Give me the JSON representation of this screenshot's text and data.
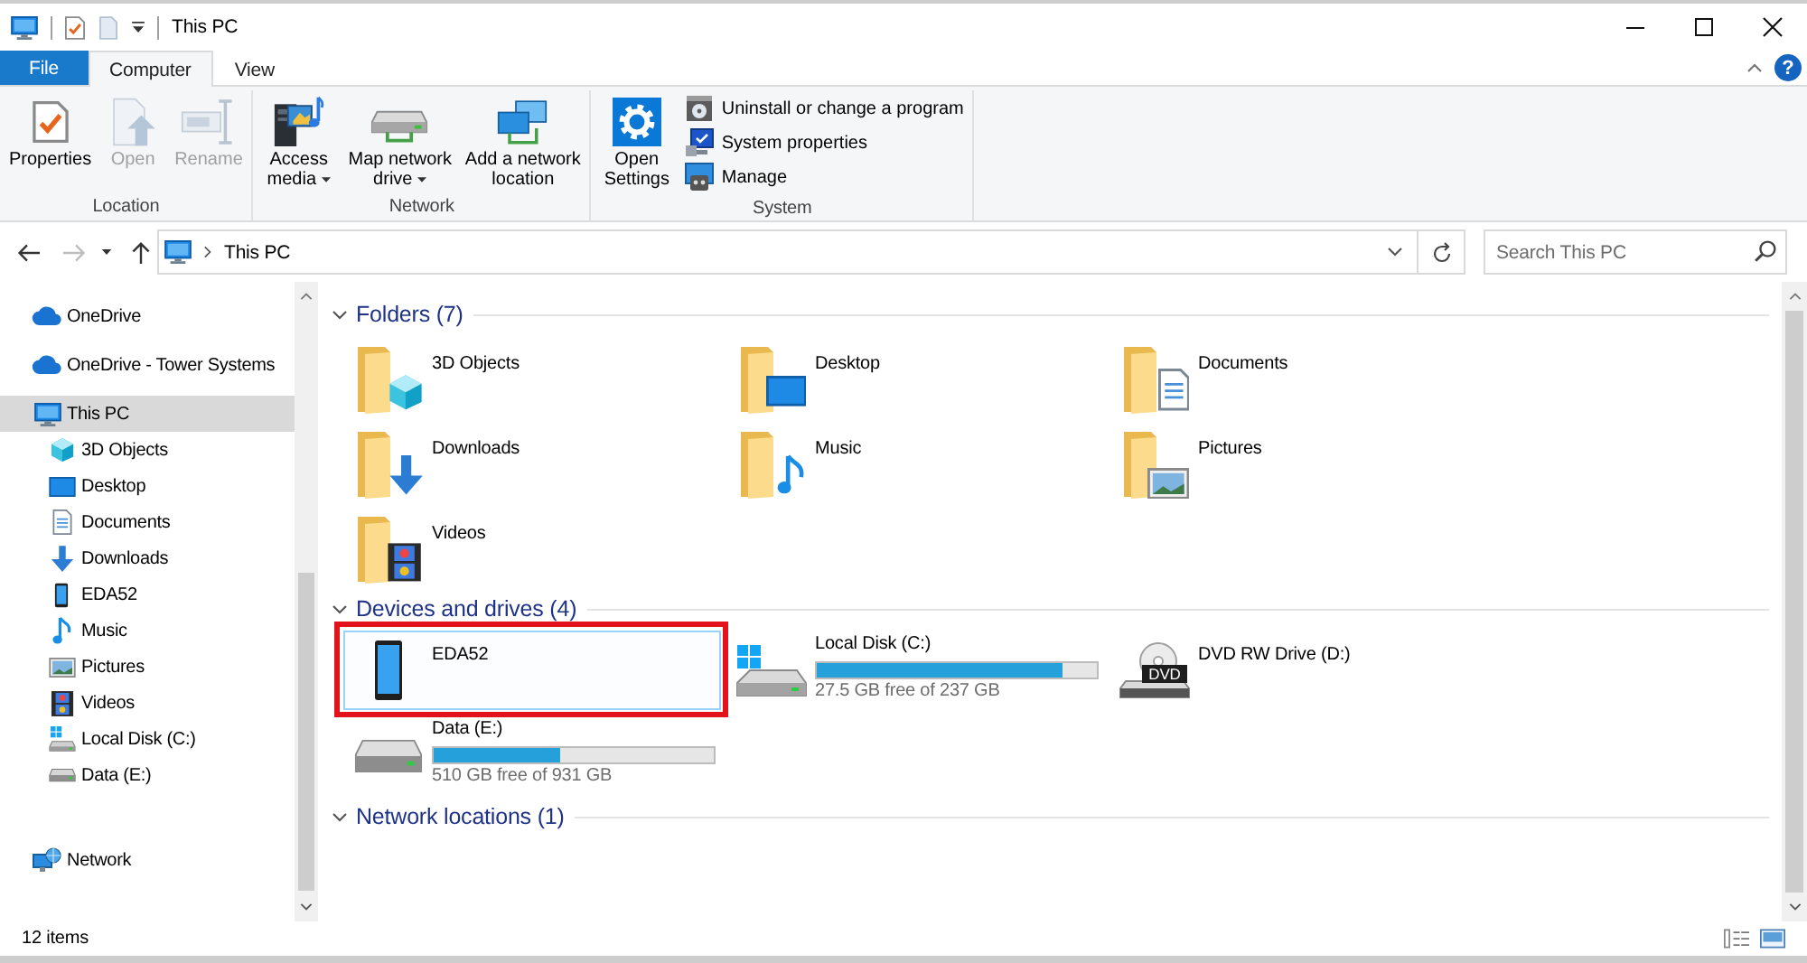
{
  "window": {
    "title": "This PC"
  },
  "ribbon": {
    "tabs": [
      {
        "label": "File",
        "kind": "file",
        "selected": false
      },
      {
        "label": "Computer",
        "kind": "tab",
        "selected": true
      },
      {
        "label": "View",
        "kind": "tab",
        "selected": false
      }
    ],
    "help_button": {
      "label": "?"
    },
    "groups": [
      {
        "label": "Location",
        "buttons": [
          {
            "label": "Properties",
            "kind": "large",
            "disabled": false,
            "dropdown": false
          },
          {
            "label": "Open",
            "kind": "large",
            "disabled": true,
            "dropdown": false
          },
          {
            "label": "Rename",
            "kind": "large",
            "disabled": true,
            "dropdown": false
          }
        ]
      },
      {
        "label": "Network",
        "buttons": [
          {
            "label": "Access media",
            "kind": "large",
            "disabled": false,
            "dropdown": true
          },
          {
            "label": "Map network drive",
            "kind": "large",
            "disabled": false,
            "dropdown": true
          },
          {
            "label": "Add a network location",
            "kind": "large",
            "disabled": false,
            "dropdown": false
          }
        ]
      },
      {
        "label": "System",
        "buttons": [
          {
            "label": "Open Settings",
            "kind": "large",
            "disabled": false,
            "dropdown": false
          },
          {
            "label": "Uninstall or change a program",
            "kind": "small",
            "disabled": false,
            "dropdown": false
          },
          {
            "label": "System properties",
            "kind": "small",
            "disabled": false,
            "dropdown": false
          },
          {
            "label": "Manage",
            "kind": "small",
            "disabled": false,
            "dropdown": false
          }
        ]
      }
    ]
  },
  "address": {
    "path": [
      "This PC"
    ]
  },
  "search": {
    "placeholder": "Search This PC"
  },
  "nav": {
    "items": [
      {
        "label": "OneDrive",
        "selected": false
      },
      {
        "label": "OneDrive - Tower Systems",
        "selected": false
      },
      {
        "label": "This PC",
        "selected": true,
        "children": [
          {
            "label": "3D Objects",
            "selected": false
          },
          {
            "label": "Desktop",
            "selected": false
          },
          {
            "label": "Documents",
            "selected": false
          },
          {
            "label": "Downloads",
            "selected": false
          },
          {
            "label": "EDA52",
            "selected": false
          },
          {
            "label": "Music",
            "selected": false
          },
          {
            "label": "Pictures",
            "selected": false
          },
          {
            "label": "Videos",
            "selected": false
          },
          {
            "label": "Local Disk (C:)",
            "selected": false
          },
          {
            "label": "Data (E:)",
            "selected": false
          }
        ]
      },
      {
        "label": "Network",
        "selected": false
      }
    ]
  },
  "content": {
    "groups": [
      {
        "title": "Folders (7)",
        "expanded": true,
        "items": [
          {
            "name": "3D Objects",
            "kind": "folder",
            "selected": false
          },
          {
            "name": "Desktop",
            "kind": "folder",
            "selected": false
          },
          {
            "name": "Documents",
            "kind": "folder",
            "selected": false
          },
          {
            "name": "Downloads",
            "kind": "folder",
            "selected": false
          },
          {
            "name": "Music",
            "kind": "folder",
            "selected": false
          },
          {
            "name": "Pictures",
            "kind": "folder",
            "selected": false
          },
          {
            "name": "Videos",
            "kind": "folder",
            "selected": false
          }
        ]
      },
      {
        "title": "Devices and drives (4)",
        "expanded": true,
        "items": [
          {
            "name": "EDA52",
            "kind": "device",
            "selected": true,
            "highlighted": true
          },
          {
            "name": "Local Disk (C:)",
            "kind": "system_drive",
            "selected": false,
            "highlighted": false,
            "level": 0.88,
            "free": "27.5 GB free of 237 GB"
          },
          {
            "name": "DVD RW Drive (D:)",
            "kind": "optical_drive",
            "badge": "DVD",
            "selected": false,
            "highlighted": false
          },
          {
            "name": "Data (E:)",
            "kind": "drive",
            "selected": false,
            "highlighted": false,
            "level": 0.45,
            "free": "510 GB free of 931 GB"
          }
        ]
      },
      {
        "title": "Network locations (1)",
        "expanded": true
      }
    ]
  },
  "status_bar": {
    "item_count": "12 items"
  }
}
